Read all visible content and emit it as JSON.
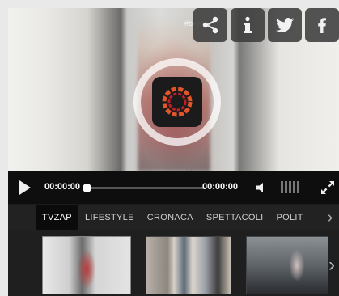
{
  "share": {
    "share_icon": "share-icon",
    "info_icon": "info-icon",
    "twitter_icon": "twitter-icon",
    "facebook_icon": "facebook-icon"
  },
  "video": {
    "watermark": "#beyon"
  },
  "controls": {
    "current_time": "00:00:00",
    "duration": "00:00:00",
    "progress": 0
  },
  "tabs": [
    {
      "label": "TVZAP",
      "active": true
    },
    {
      "label": "LIFESTYLE",
      "active": false
    },
    {
      "label": "CRONACA",
      "active": false
    },
    {
      "label": "SPETTACOLI",
      "active": false
    },
    {
      "label": "POLIT",
      "active": false
    }
  ],
  "colors": {
    "accent": "#ffffff",
    "player_bg": "#1c1c1c",
    "logo_orange": "#e0552a",
    "logo_red": "#b8202a"
  }
}
